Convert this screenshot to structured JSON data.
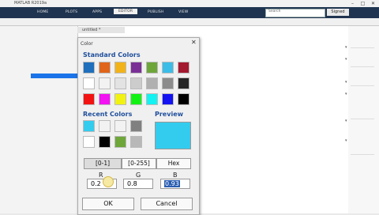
{
  "window": {
    "title": "MATLAB R2019a"
  },
  "ribbon": {
    "tabs": [
      "HOME",
      "PLOTS",
      "APPS",
      "EDITOR",
      "PUBLISH",
      "VIEW"
    ],
    "search_placeholder": "Search",
    "signin": "Signed"
  },
  "editor": {
    "tab_label": "untitled *"
  },
  "dialog": {
    "title": "Color",
    "standard_colors_label": "Standard Colors",
    "recent_colors_label": "Recent Colors",
    "preview_label": "Preview",
    "standard_swatches": [
      "#1f6fbd",
      "#e0651b",
      "#f2b21a",
      "#7a2f97",
      "#6ea63a",
      "#3cbde8",
      "#a3192f",
      "#ffffff",
      "#f2f2f2",
      "#e3e3e3",
      "#cccccc",
      "#b0b0b0",
      "#8c8c8c",
      "#262626",
      "#f21212",
      "#f212f2",
      "#f2f212",
      "#12f212",
      "#12f2f2",
      "#1212f2",
      "#000000"
    ],
    "recent_swatches": [
      "#33ccee",
      "#f2f2f2",
      "#f2f2f2",
      "#808080",
      "#ffffff",
      "#000000",
      "#6ea63a",
      "#b8b8b8"
    ],
    "preview_color": "#33ccee",
    "modes": [
      "[0-1]",
      "[0-255]",
      "Hex"
    ],
    "channels": [
      {
        "label": "R",
        "value": "0.2"
      },
      {
        "label": "G",
        "value": "0.8"
      },
      {
        "label": "B",
        "value": "0.93"
      }
    ],
    "ok_label": "OK",
    "cancel_label": "Cancel"
  }
}
